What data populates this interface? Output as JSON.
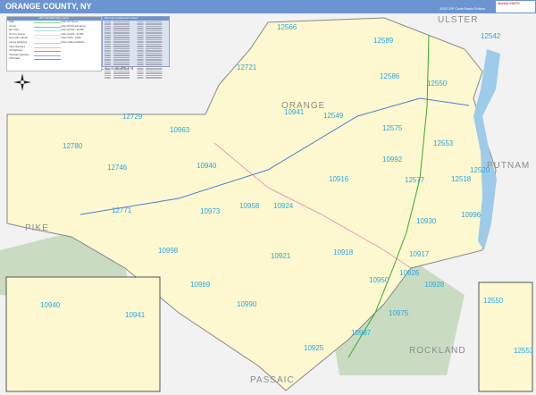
{
  "header": {
    "title": "ORANGE COUNTY, NY",
    "edition": "2022 ZIP Code Basic Edition",
    "logo_text": "Market MAPS"
  },
  "legend": {
    "title": "ZIP Code Basic Map Legend",
    "items": [
      "State",
      "County",
      "ZIP Code",
      "Primary Streets",
      "Secondary Streets",
      "County Highways",
      "State Highways",
      "US Highways",
      "Interstate Highways",
      "Toll Roads"
    ],
    "cities_title": "Cities and Towns",
    "cities": [
      "Cities 50,000 and above",
      "Cities 25,000 - 49,999",
      "Cities 10,000 - 24,999",
      "Cities 5,000 - 9,999",
      "Cities 4,999 and Below"
    ],
    "colors": {
      "state": "#7fd88a",
      "county": "#aaaaaa",
      "zip": "#a8e4f0",
      "state_hwy": "#f5c56b",
      "us_hwy": "#e96fb4",
      "interstate": "#6fb7e8",
      "toll": "#33cc33"
    }
  },
  "index": {
    "title": "ZIP Codes Included and Location"
  },
  "regions": [
    "ULSTER",
    "SULLIVAN",
    "ORANGE",
    "PUTNAM",
    "PIKE",
    "ROCKLAND",
    "PASSAIC"
  ],
  "zips": [
    "12566",
    "12589",
    "12542",
    "12721",
    "12586",
    "12550",
    "12729",
    "12549",
    "10941",
    "12575",
    "12553",
    "12780",
    "10963",
    "10992",
    "12746",
    "10940",
    "12520",
    "12577",
    "12518",
    "10916",
    "12771",
    "10973",
    "10958",
    "10924",
    "10996",
    "10930",
    "10998",
    "10921",
    "10918",
    "10917",
    "10926",
    "10969",
    "10950",
    "10928",
    "10990",
    "10975",
    "10987",
    "10925"
  ],
  "insets": {
    "left": [
      "10940",
      "10941"
    ],
    "right": [
      "12550",
      "12553"
    ]
  },
  "colors": {
    "land": "#fdf8cf",
    "outside": "#f2f2f2",
    "water": "#9ecbea",
    "park": "#c9dcc2",
    "zip_label": "#29a7dd",
    "header": "#6b94d0"
  }
}
